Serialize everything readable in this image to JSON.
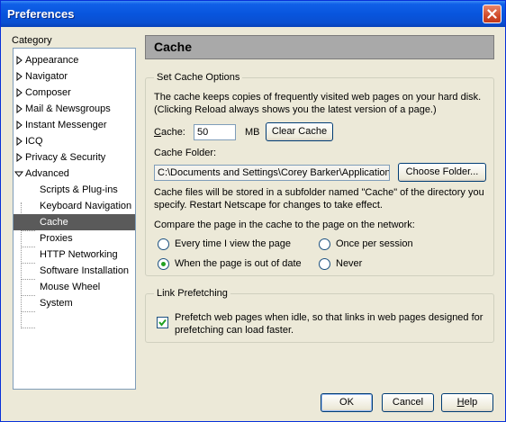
{
  "window": {
    "title": "Preferences"
  },
  "category_label": "Category",
  "tree": [
    {
      "label": "Appearance"
    },
    {
      "label": "Navigator"
    },
    {
      "label": "Composer"
    },
    {
      "label": "Mail & Newsgroups"
    },
    {
      "label": "Instant Messenger"
    },
    {
      "label": "ICQ"
    },
    {
      "label": "Privacy & Security"
    },
    {
      "label": "Advanced",
      "expanded": true
    },
    {
      "label": "Scripts & Plug-ins"
    },
    {
      "label": "Keyboard Navigation"
    },
    {
      "label": "Cache",
      "selected": true
    },
    {
      "label": "Proxies"
    },
    {
      "label": "HTTP Networking"
    },
    {
      "label": "Software Installation"
    },
    {
      "label": "Mouse Wheel"
    },
    {
      "label": "System"
    }
  ],
  "panel": {
    "title": "Cache",
    "cache_options": {
      "legend": "Set Cache Options",
      "description1": "The cache keeps copies of frequently visited web pages on your hard disk.",
      "description2": "(Clicking Reload always shows you the latest version of a page.)",
      "cache_label_first": "C",
      "cache_label_rest": "ache:",
      "cache_value": "50",
      "cache_unit": "MB",
      "clear_cache_button": "Clear Cache",
      "folder_label": "Cache Folder:",
      "folder_value": "C:\\Documents and Settings\\Corey Barker\\Application",
      "choose_folder_button": "Choose Folder...",
      "note1": "Cache files will be stored in a subfolder named \"Cache\" of the directory you",
      "note2": "specify. Restart Netscape for changes to take effect.",
      "compare_label": "Compare the page in the cache to the page on the network:",
      "radio_every_time": "Every time I view the page",
      "radio_once_session": "Once per session",
      "radio_out_of_date": "When the page is out of date",
      "radio_never": "Never",
      "selected_option": "When the page is out of date"
    },
    "prefetch": {
      "legend": "Link Prefetching",
      "checkbox_line1": "Prefetch web pages when idle, so that links in web pages designed for",
      "checkbox_line2": "prefetching can load faster.",
      "checked": true
    }
  },
  "buttons": {
    "ok": "OK",
    "cancel": "Cancel",
    "help_first": "H",
    "help_rest": "elp"
  },
  "colors": {
    "titlebar": "#0a4fd0",
    "selection": "#5a5a5a",
    "radio_dot": "#21a121"
  }
}
